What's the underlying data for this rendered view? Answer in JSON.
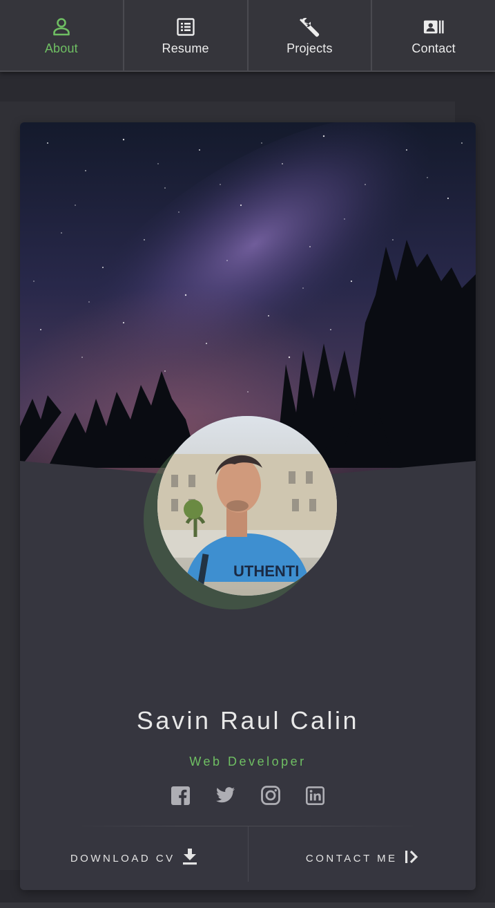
{
  "nav": {
    "items": [
      {
        "label": "About",
        "icon": "person-icon",
        "active": true
      },
      {
        "label": "Resume",
        "icon": "list-icon",
        "active": false
      },
      {
        "label": "Projects",
        "icon": "wrench-icon",
        "active": false
      },
      {
        "label": "Contact",
        "icon": "contact-card-icon",
        "active": false
      }
    ]
  },
  "profile": {
    "name": "Savin Raul Calin",
    "role": "Web Developer",
    "cover_image": "starry-night-forest",
    "avatar_image": "profile-photo"
  },
  "socials": [
    {
      "icon": "facebook-icon"
    },
    {
      "icon": "twitter-icon"
    },
    {
      "icon": "instagram-icon"
    },
    {
      "icon": "linkedin-icon"
    }
  ],
  "actions": {
    "download_cv": "DOWNLOAD CV",
    "contact_me": "CONTACT ME"
  },
  "colors": {
    "accent": "#6fbf63",
    "background": "#2a2a30",
    "card": "#36363f",
    "nav": "#35353b"
  }
}
